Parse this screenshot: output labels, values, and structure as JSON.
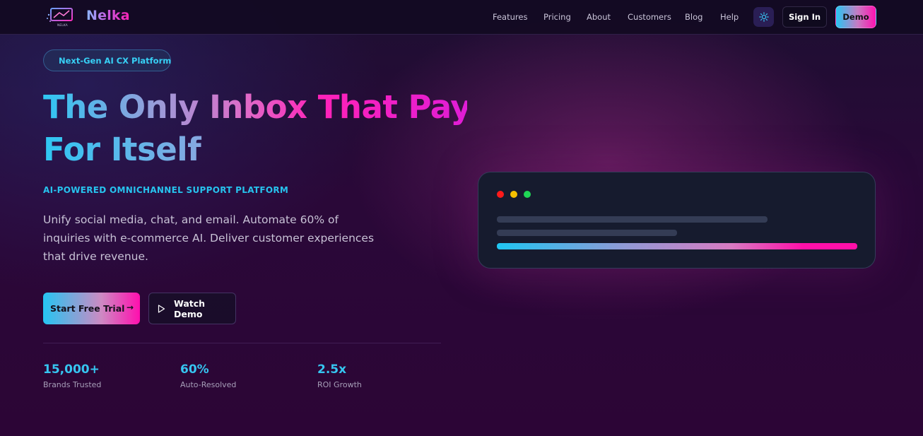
{
  "nav": {
    "brand": "Nelka",
    "logo_text": "NELKA",
    "links": [
      "Features",
      "Pricing",
      "About",
      "Customers",
      "Blog",
      "Help"
    ],
    "theme_icon": "sun-icon",
    "signin_label": "Sign In",
    "demo_label": "Demo"
  },
  "hero": {
    "badge": "Next-Gen AI CX Platform",
    "badge_icon": "rocket-icon",
    "headline_line1": "The Only Inbox That Pays",
    "headline_line2": "For Itself",
    "kicker": "AI-POWERED OMNICHANNEL SUPPORT PLATFORM",
    "description": "Unify social media, chat, and email. Automate 60% of inquiries with e-commerce AI. Deliver customer experiences that drive revenue.",
    "cta_primary": "Start Free Trial",
    "cta_primary_icon": "arrow-right-icon",
    "cta_secondary": "Watch Demo",
    "cta_secondary_icon": "play-icon"
  },
  "stats": [
    {
      "value": "15,000+",
      "label": "Brands Trusted"
    },
    {
      "value": "60%",
      "label": "Auto-Resolved"
    },
    {
      "value": "2.5x",
      "label": "ROI Growth"
    }
  ],
  "mockup": {
    "window_dot_colors": [
      "#ff1a1a",
      "#f5c000",
      "#1fd655"
    ],
    "progress_fraction": 1.0
  },
  "colors": {
    "accent_cyan": "#27c3ee",
    "accent_pink": "#ff12b0"
  }
}
